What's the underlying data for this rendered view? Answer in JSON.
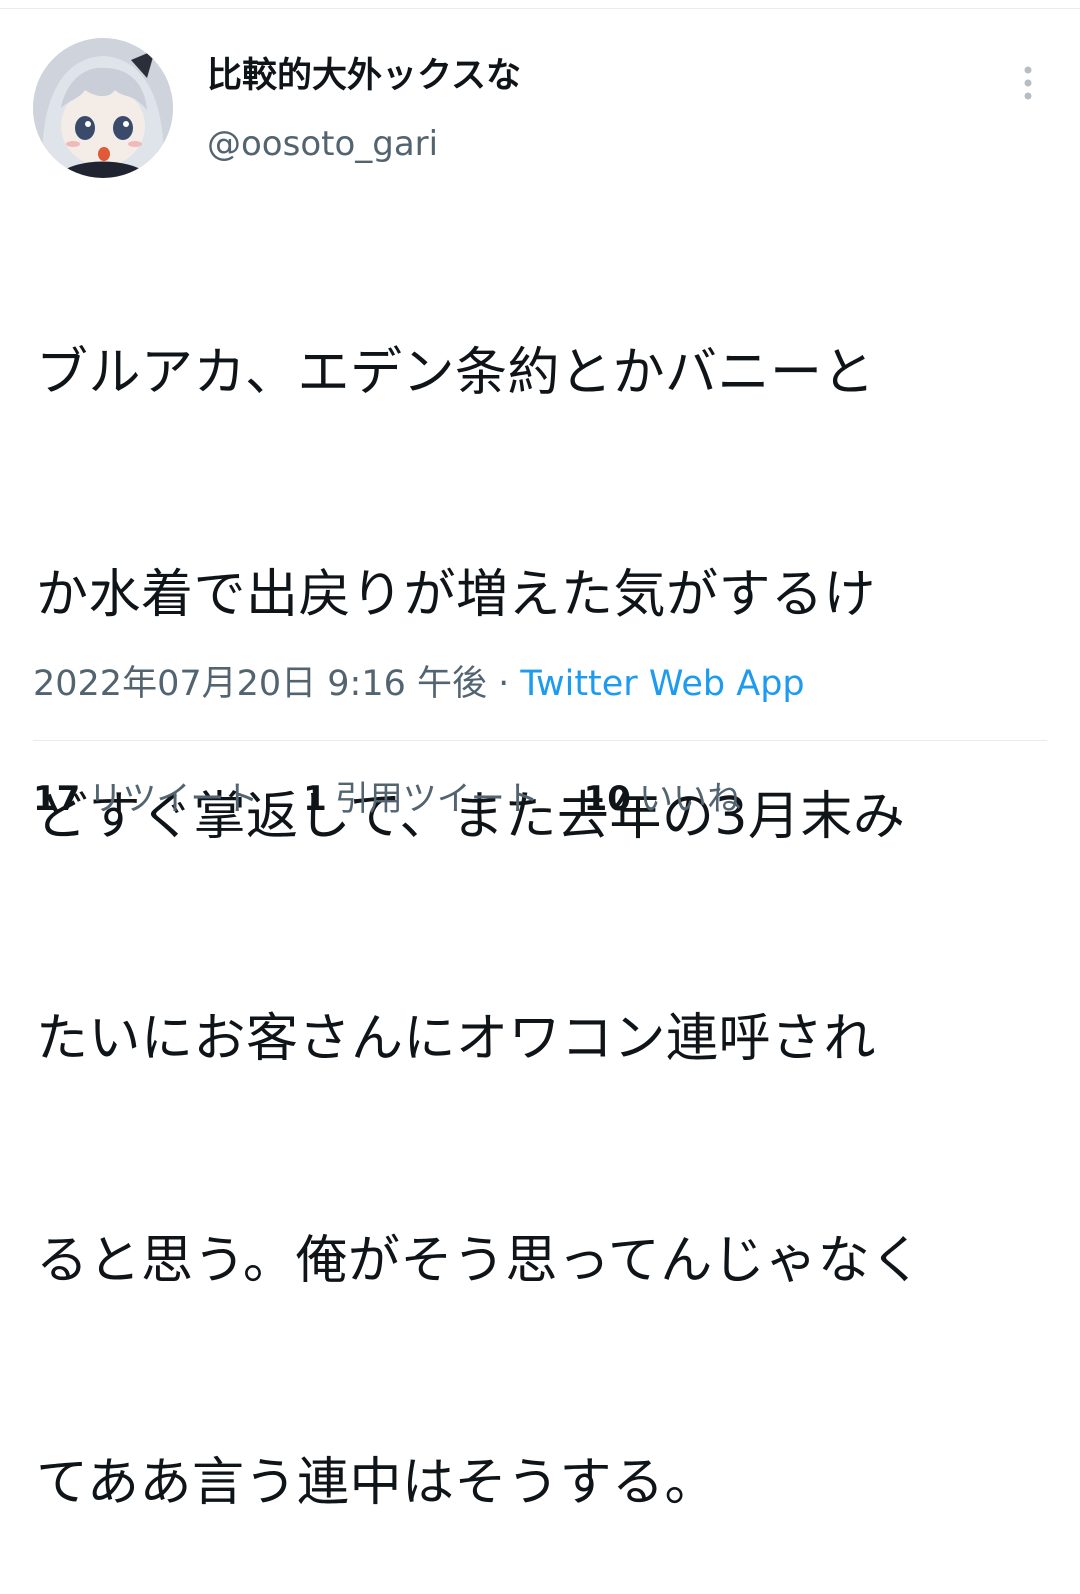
{
  "user": {
    "display_name": "比較的大外ックスな",
    "handle": "@oosoto_gari"
  },
  "tweet": {
    "text_lines": [
      "ブルアカ、エデン条約とかバニーと",
      "か水着で出戻りが増えた気がするけ",
      "どすぐ掌返して、また去年の3月末み",
      "たいにお客さんにオワコン連呼され",
      "ると思う。俺がそう思ってんじゃなく",
      "てああ言う連中はそうする。"
    ],
    "timestamp": "2022年07月20日 9:16 午後",
    "separator": " · ",
    "source": "Twitter Web App"
  },
  "stats": {
    "retweets": {
      "count": "17",
      "label": "リツイート"
    },
    "quotes": {
      "count": "1",
      "label": "引用ツイート"
    },
    "likes": {
      "count": "10",
      "label": "いいね"
    }
  },
  "icons": {
    "more": "more-vertical-icon",
    "avatar": "avatar-image"
  },
  "colors": {
    "text": "#0f1419",
    "secondary": "#536471",
    "link": "#1d9bf0",
    "divider": "#e6ecf0"
  }
}
